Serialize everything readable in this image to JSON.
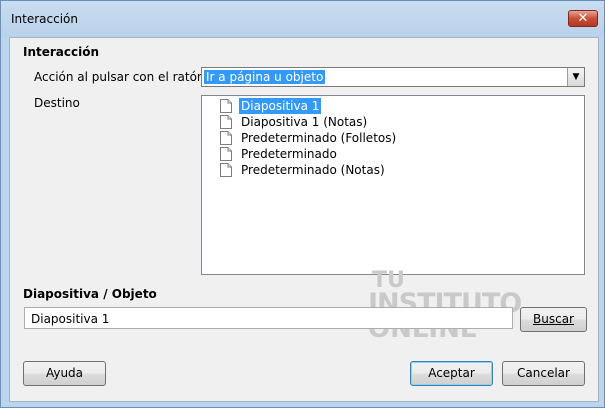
{
  "window": {
    "title": "Interacción",
    "close_label": "✕"
  },
  "section1": {
    "heading": "Interacción"
  },
  "action": {
    "label": "Acción al pulsar con el ratón:",
    "value": "Ir a página u objeto"
  },
  "destino": {
    "label": "Destino",
    "items": [
      {
        "label": "Diapositiva 1",
        "selected": true
      },
      {
        "label": "Diapositiva 1 (Notas)",
        "selected": false
      },
      {
        "label": "Predeterminado (Folletos)",
        "selected": false
      },
      {
        "label": "Predeterminado",
        "selected": false
      },
      {
        "label": "Predeterminado (Notas)",
        "selected": false
      }
    ]
  },
  "section2": {
    "heading": "Diapositiva / Objeto"
  },
  "object_field": {
    "value": "Diapositiva 1"
  },
  "buttons": {
    "search": "Buscar",
    "help": "Ayuda",
    "accept": "Aceptar",
    "cancel": "Cancelar"
  },
  "watermark": {
    "line1": "TU",
    "line2": "INSTITUTO",
    "line3": "ONLINE"
  }
}
